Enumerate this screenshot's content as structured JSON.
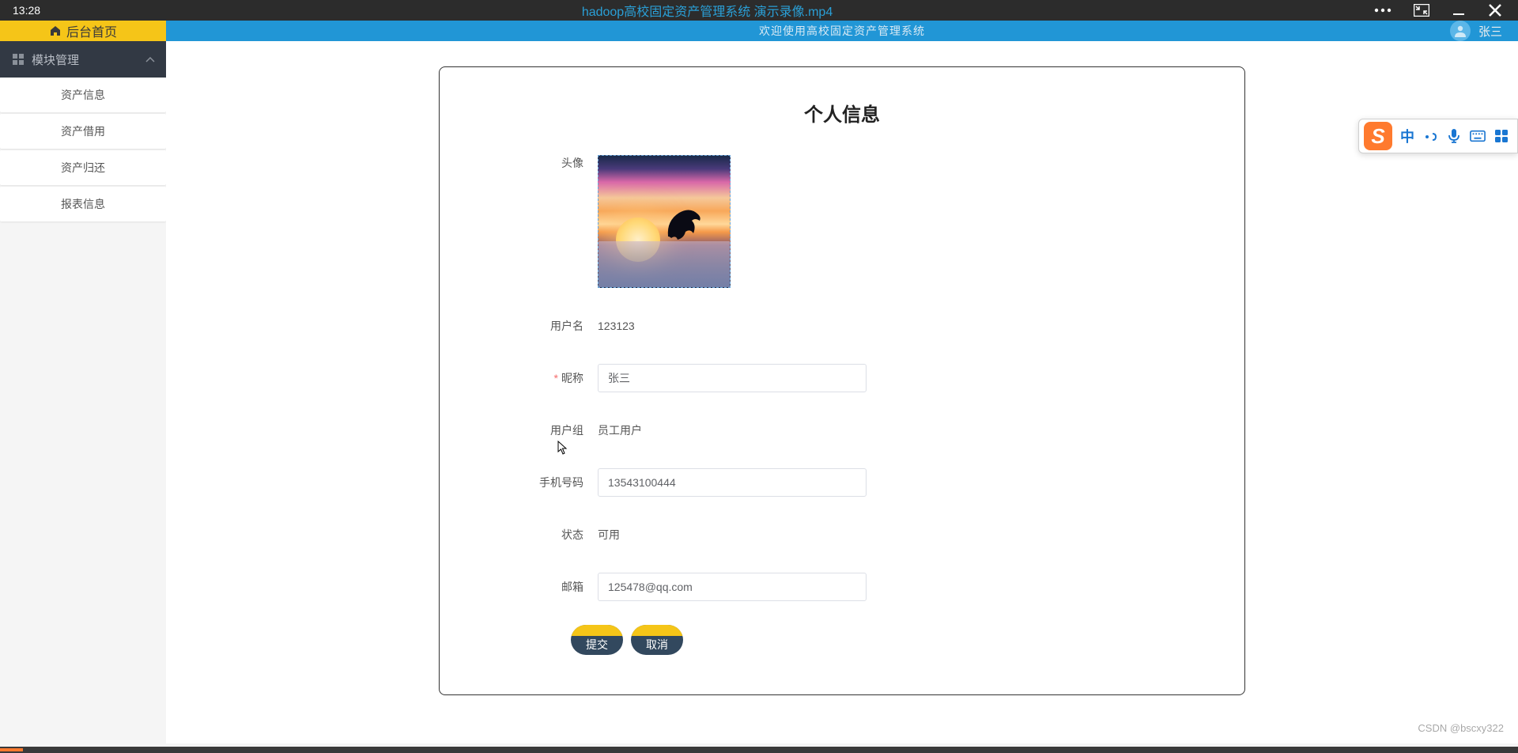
{
  "video": {
    "time": "13:28",
    "title": "hadoop高校固定资产管理系统 演示录像.mp4"
  },
  "header": {
    "home_label": "后台首页",
    "welcome": "欢迎使用高校固定资产管理系统",
    "user_name": "张三"
  },
  "sidebar": {
    "group_label": "模块管理",
    "items": [
      {
        "label": "资产信息"
      },
      {
        "label": "资产借用"
      },
      {
        "label": "资产归还"
      },
      {
        "label": "报表信息"
      }
    ]
  },
  "form": {
    "title": "个人信息",
    "labels": {
      "avatar": "头像",
      "username": "用户名",
      "nickname": "昵称",
      "usergroup": "用户组",
      "phone": "手机号码",
      "status": "状态",
      "email": "邮箱"
    },
    "values": {
      "username": "123123",
      "nickname": "张三",
      "usergroup": "员工用户",
      "phone": "13543100444",
      "status": "可用",
      "email": "125478@qq.com"
    },
    "buttons": {
      "submit": "提交",
      "cancel": "取消"
    }
  },
  "ime": {
    "logo": "S",
    "lang": "中"
  },
  "watermark": "CSDN @bscxy322"
}
